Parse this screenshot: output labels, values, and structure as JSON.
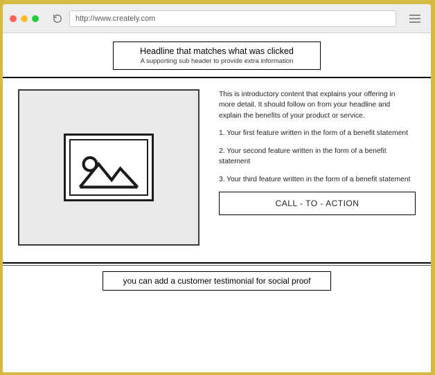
{
  "browser": {
    "url": "http://www.creately.com"
  },
  "hero": {
    "headline": "Headline that matches what was clicked",
    "subhead": "A supporting sub header to provide extra information"
  },
  "content": {
    "intro": "This is introductory content that explains your offering in more detail. It should follow on from your headline and explain the benefits of your product or service.",
    "features": [
      "1. Your first feature written in the form of a benefit statement",
      "2. Your second feature written in the form of a benefit statement",
      "3. Your third feature written in the form of a benefit statement"
    ],
    "cta": "CALL - TO - ACTION"
  },
  "testimonial": "you can add a customer testimonial for social proof"
}
